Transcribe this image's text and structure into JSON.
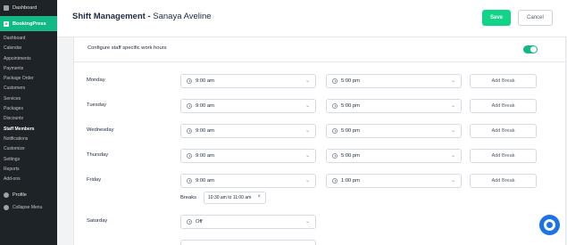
{
  "sidebar": {
    "dashboard": "Dashboard",
    "bookingpress": "BookingPress",
    "items": [
      "Dashboard",
      "Calendar",
      "Appointments",
      "Payments",
      "Package Order",
      "Customers",
      "Services",
      "Packages",
      "Discounts",
      "Staff Members",
      "Notifications",
      "Customize",
      "Settings",
      "Reports",
      "Add-ons"
    ],
    "profile": "Profile",
    "collapse": "Collapse Menu"
  },
  "header": {
    "title_main": "Shift Management",
    "title_sep": " - ",
    "title_name": "Sanaya Aveline",
    "save": "Save",
    "cancel": "Cancel"
  },
  "config": {
    "label": "Configure staff specific work hours",
    "enabled": true
  },
  "days": [
    {
      "name": "Monday",
      "start": "9:00 am",
      "end": "5:00 pm",
      "add_break": "Add Break"
    },
    {
      "name": "Tuesday",
      "start": "9:00 am",
      "end": "5:00 pm",
      "add_break": "Add Break"
    },
    {
      "name": "Wednesday",
      "start": "9:00 am",
      "end": "5:00 pm",
      "add_break": "Add Break"
    },
    {
      "name": "Thursday",
      "start": "9:00 am",
      "end": "5:00 pm",
      "add_break": "Add Break"
    },
    {
      "name": "Friday",
      "start": "9:00 am",
      "end": "1:00 pm",
      "add_break": "Add Break"
    }
  ],
  "friday_breaks": {
    "label": "Breaks",
    "items": [
      "10:30 am to 11:00 am"
    ]
  },
  "saturday": {
    "name": "Saturday",
    "value": "Off"
  },
  "colors": {
    "accent": "#12b886",
    "save": "#12d488",
    "sidebar": "#1d2327",
    "help": "#1a73e8"
  }
}
